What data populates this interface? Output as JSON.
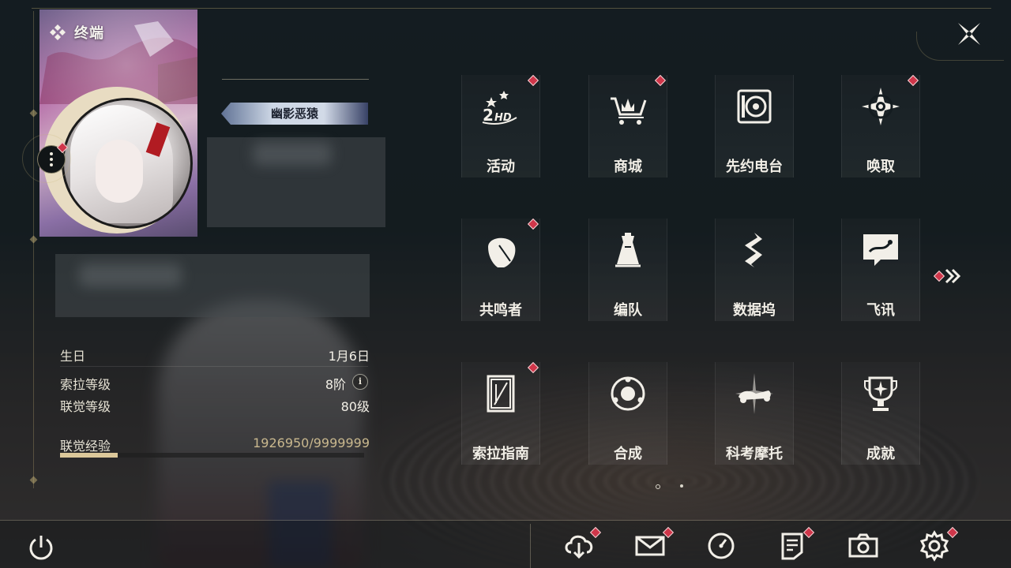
{
  "card": {
    "title": "终端"
  },
  "player": {
    "name": "幽影恶猿"
  },
  "stats": [
    {
      "label": "生日",
      "value": "1月6日"
    },
    {
      "label": "索拉等级",
      "value": "8阶"
    },
    {
      "label": "联觉等级",
      "value": "80级"
    }
  ],
  "info_icon": "i",
  "exp": {
    "label": "联觉经验",
    "value": "1926950/9999999",
    "progress": 0.19
  },
  "menu": [
    {
      "label": "活动",
      "icon": "event-2hd-icon",
      "alert": true
    },
    {
      "label": "商城",
      "icon": "shop-cart-icon",
      "alert": true
    },
    {
      "label": "先约电台",
      "icon": "radio-icon",
      "alert": false
    },
    {
      "label": "唤取",
      "icon": "convene-star-icon",
      "alert": true
    },
    {
      "label": "共鸣者",
      "icon": "resonator-head-icon",
      "alert": true
    },
    {
      "label": "编队",
      "icon": "team-chess-icon",
      "alert": false
    },
    {
      "label": "数据坞",
      "icon": "data-bank-icon",
      "alert": false
    },
    {
      "label": "飞讯",
      "icon": "chat-message-icon",
      "alert": false
    },
    {
      "label": "索拉指南",
      "icon": "guide-book-icon",
      "alert": true
    },
    {
      "label": "合成",
      "icon": "synthesis-icon",
      "alert": false
    },
    {
      "label": "科考摩托",
      "icon": "motorcycle-icon",
      "alert": false
    },
    {
      "label": "成就",
      "icon": "trophy-icon",
      "alert": false
    }
  ],
  "pagination": {
    "current": 1,
    "total": 2
  },
  "bottom_bar": [
    {
      "icon": "download-icon",
      "alert": true
    },
    {
      "icon": "mail-icon",
      "alert": true
    },
    {
      "icon": "clock-icon",
      "alert": false
    },
    {
      "icon": "notice-icon",
      "alert": true
    },
    {
      "icon": "camera-icon",
      "alert": false
    },
    {
      "icon": "settings-gear-icon",
      "alert": true
    }
  ],
  "colors": {
    "accent_gold": "#dcc89a",
    "alert_red": "#d0364a",
    "text": "#f1eee6"
  }
}
